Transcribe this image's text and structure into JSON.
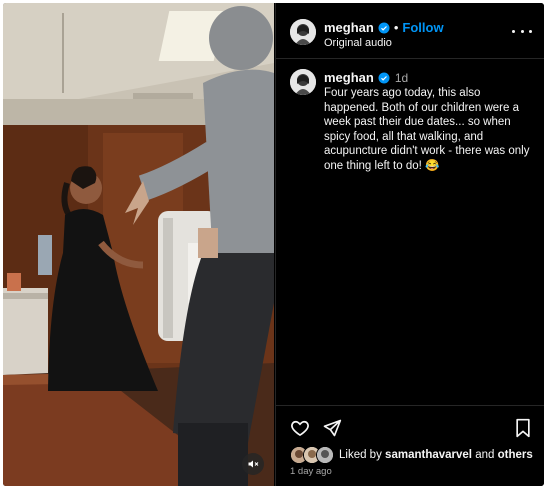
{
  "post": {
    "username": "meghan",
    "follow_label": "Follow",
    "separator": "•",
    "audio_label": "Original audio",
    "caption_time": "1d",
    "caption_text": "Four years ago today, this also happened. Both of our children were a week past their due dates... so when spicy food, all that walking, and acupuncture didn't work - there was only one thing left to do! 😂",
    "likes_prefix": "Liked by",
    "likes_user": "samanthavarvel",
    "likes_and": "and",
    "likes_others": "others",
    "posted_ago": "1 day ago"
  },
  "icons": {
    "verified": "verified-badge-icon",
    "more": "more-options-icon",
    "like": "heart-icon",
    "share": "share-paper-plane-icon",
    "save": "bookmark-icon",
    "mute": "muted-speaker-icon"
  },
  "colors": {
    "accent": "#0095f6",
    "background": "#000000",
    "text_primary": "#f5f5f5",
    "text_secondary": "#a8a8a8",
    "divider": "#262626"
  }
}
